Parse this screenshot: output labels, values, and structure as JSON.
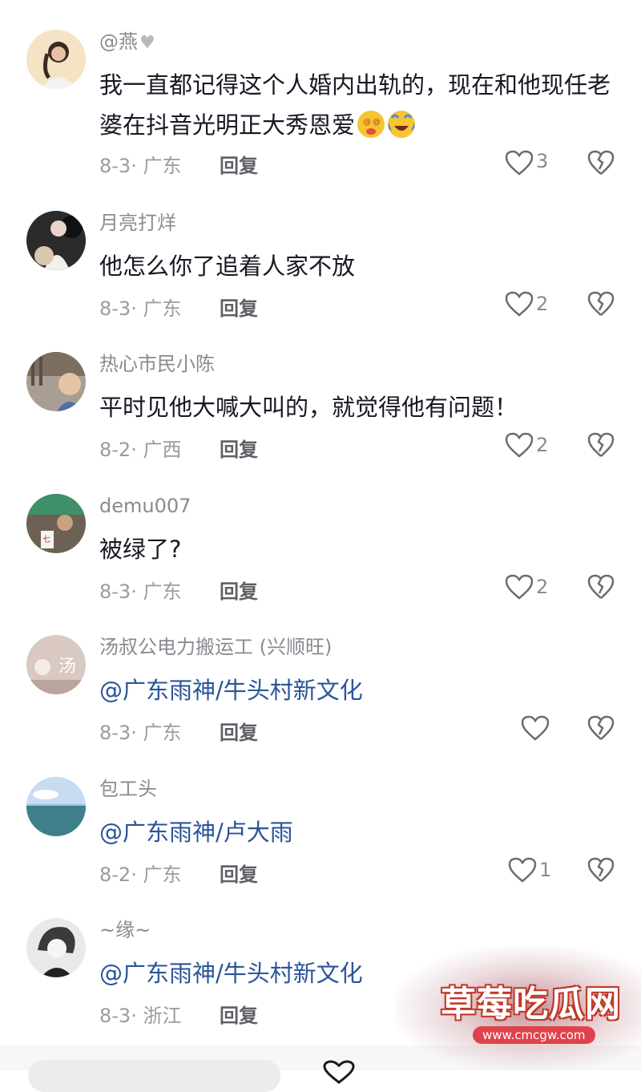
{
  "comments": [
    {
      "username": "@燕",
      "content": "我一直都记得这个人婚内出轨的，现在和他现任老婆在抖音光明正大秀恩爱",
      "date_location": "8-3· 广东",
      "reply_label": "回复",
      "likes": "3"
    },
    {
      "username": "月亮打烊",
      "content": "他怎么你了追着人家不放",
      "date_location": "8-3· 广东",
      "reply_label": "回复",
      "likes": "2"
    },
    {
      "username": "热心市民小陈",
      "content": "平时见他大喊大叫的，就觉得他有问题！",
      "date_location": "8-2· 广西",
      "reply_label": "回复",
      "likes": "2"
    },
    {
      "username": "demu007",
      "content": "被绿了?",
      "date_location": "8-3· 广东",
      "reply_label": "回复",
      "likes": "2"
    },
    {
      "username": "汤叔公电力搬运工 (兴顺旺)",
      "content": "@广东雨神/牛头村新文化",
      "date_location": "8-3· 广东",
      "reply_label": "回复",
      "likes": ""
    },
    {
      "username": "包工头",
      "content": "@广东雨神/卢大雨",
      "date_location": "8-2· 广东",
      "reply_label": "回复",
      "likes": "1"
    },
    {
      "username": "~缘~",
      "content": "@广东雨神/牛头村新文化",
      "date_location": "8-3· 浙江",
      "reply_label": "回复",
      "likes": ""
    }
  ],
  "watermark": {
    "title": "草莓吃瓜网",
    "url": "www.cmcgw.com"
  },
  "icons": {
    "like": "heart-outline-icon",
    "dislike": "broken-heart-icon"
  },
  "colors": {
    "mention": "#2b5598",
    "username": "#8a8b91",
    "watermark_red": "#e0424b"
  }
}
